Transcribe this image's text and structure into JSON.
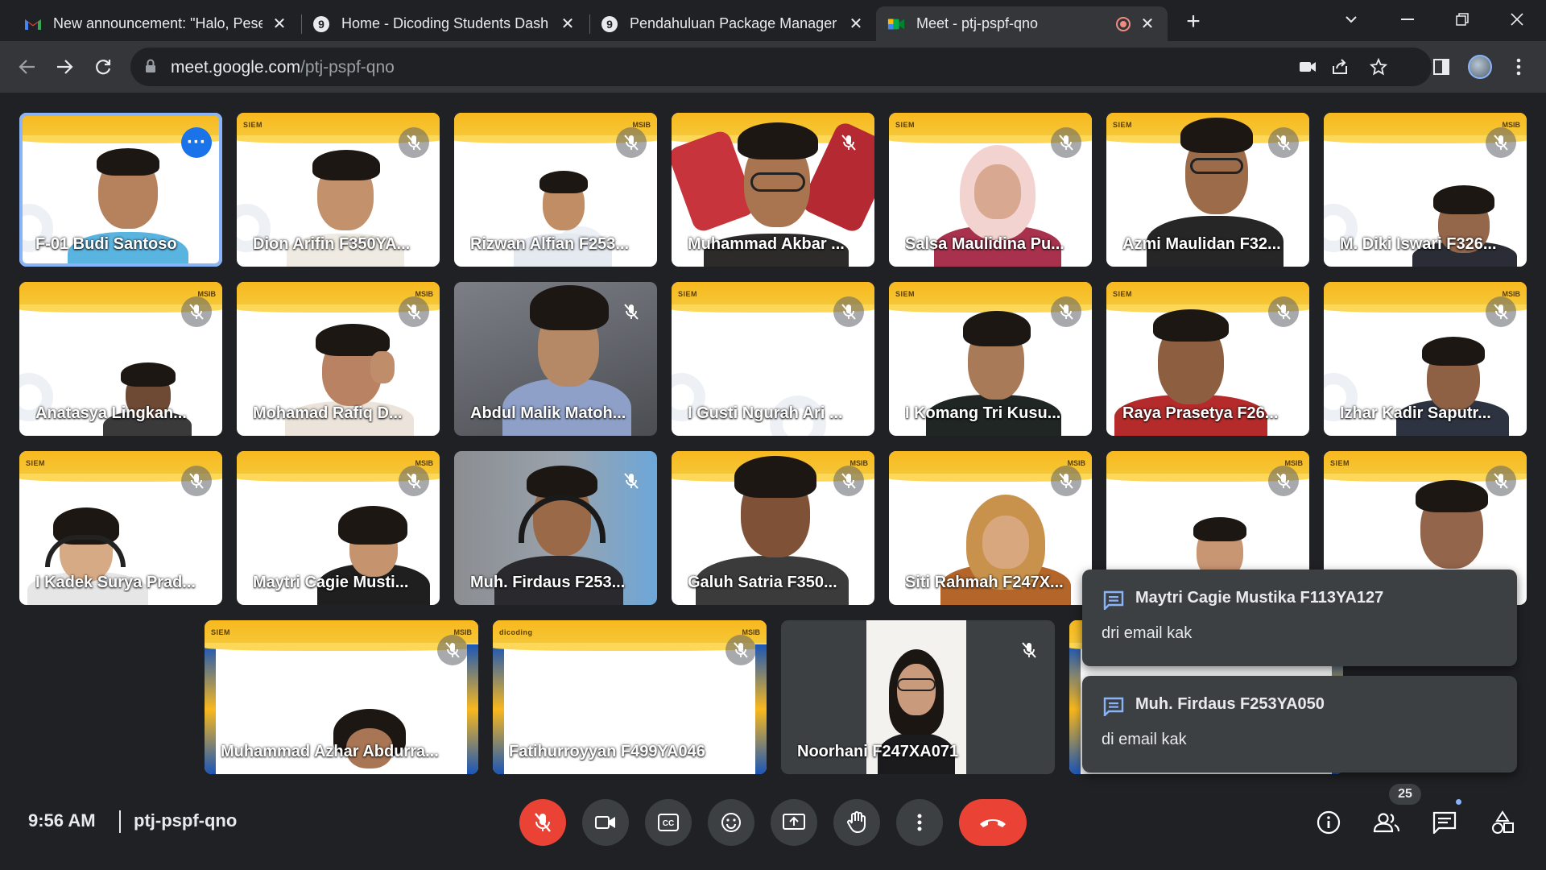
{
  "browser": {
    "tabs": [
      {
        "title": "New announcement: \"Halo, Pese",
        "favicon": "gmail-icon"
      },
      {
        "title": "Home - Dicoding Students Dash",
        "favicon": "dicoding-icon"
      },
      {
        "title": "Pendahuluan Package Manager |",
        "favicon": "dicoding-icon"
      },
      {
        "title": "Meet - ptj-pspf-qno",
        "favicon": "meet-icon"
      }
    ],
    "url_host": "meet.google.com",
    "url_path": "/ptj-pspf-qno"
  },
  "tiles": [
    {
      "name": "F-01 Budi Santoso",
      "state": "more"
    },
    {
      "name": "Dion Arifin F350YA...",
      "state": "muted"
    },
    {
      "name": "Rizwan Alfian F253...",
      "state": "muted"
    },
    {
      "name": "Muhammad Akbar ...",
      "state": "muted"
    },
    {
      "name": "Salsa Maulidina Pu...",
      "state": "muted"
    },
    {
      "name": "Azmi Maulidan F32...",
      "state": "muted"
    },
    {
      "name": "M. Diki Iswari F326...",
      "state": "muted"
    },
    {
      "name": "Anatasya Lingkan...",
      "state": "muted"
    },
    {
      "name": "Mohamad Rafiq D...",
      "state": "muted"
    },
    {
      "name": "Abdul Malik Matoh...",
      "state": "muted"
    },
    {
      "name": "I Gusti Ngurah Ari ...",
      "state": "muted"
    },
    {
      "name": "I Komang Tri Kusu...",
      "state": "muted"
    },
    {
      "name": "Raya Prasetya F26...",
      "state": "muted"
    },
    {
      "name": "Izhar Kadir Saputr...",
      "state": "muted"
    },
    {
      "name": "I Kadek Surya Prad...",
      "state": "muted"
    },
    {
      "name": "Maytri Cagie Musti...",
      "state": "muted"
    },
    {
      "name": "Muh. Firdaus F253...",
      "state": "muted"
    },
    {
      "name": "Galuh Satria F350...",
      "state": "muted"
    },
    {
      "name": "Siti Rahmah F247X...",
      "state": "muted"
    },
    {
      "name": "",
      "state": "muted"
    },
    {
      "name": "",
      "state": "muted"
    },
    {
      "name": "Muhammad Azhar Abdurra...",
      "state": "muted"
    },
    {
      "name": "Fatihurroyyan F499YA046",
      "state": "muted"
    },
    {
      "name": "Noorhani F247XA071",
      "state": "muted"
    }
  ],
  "chat_toasts": [
    {
      "sender": "Maytri Cagie Mustika F113YA127",
      "message": "dri email kak"
    },
    {
      "sender": "Muh. Firdaus F253YA050",
      "message": "di email kak"
    }
  ],
  "bottom": {
    "time": "9:56 AM",
    "meeting_code": "ptj-pspf-qno",
    "participant_count": "25"
  },
  "colors": {
    "background": "#202124",
    "accent_blue": "#8ab4f8",
    "danger_red": "#ea4335",
    "brand_yellow": "#f8b81e"
  }
}
